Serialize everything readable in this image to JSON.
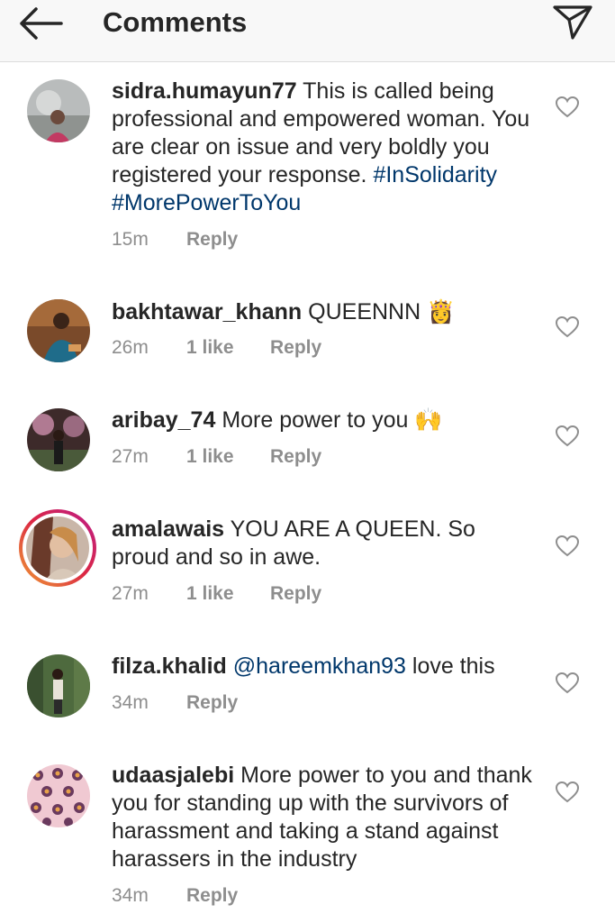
{
  "header": {
    "title": "Comments",
    "back_icon": "arrow-left-icon",
    "share_icon": "paper-plane-icon"
  },
  "comments": [
    {
      "username": "sidra.humayun77",
      "text": "This is called being professional and empowered woman. You are clear on issue and very boldly you registered your response.",
      "hashtags": [
        "#InSolidarity",
        "#MorePowerToYou"
      ],
      "time": "15m",
      "reply_label": "Reply"
    },
    {
      "username": "bakhtawar_khann",
      "text": "QUEENNN 👸",
      "time": "26m",
      "likes": "1 like",
      "reply_label": "Reply"
    },
    {
      "username": "aribay_74",
      "text": "More power to you 🙌",
      "time": "27m",
      "likes": "1 like",
      "reply_label": "Reply"
    },
    {
      "username": "amalawais",
      "text": "YOU ARE A QUEEN. So proud and so in awe.",
      "time": "27m",
      "likes": "1 like",
      "reply_label": "Reply"
    },
    {
      "username": "filza.khalid",
      "mention": "@hareemkhan93",
      "text": "love this",
      "time": "34m",
      "reply_label": "Reply"
    },
    {
      "username": "udaasjalebi",
      "text": "More power to you and thank you for standing up with the survivors of harassment and taking a stand against harassers in the industry",
      "time": "34m",
      "reply_label": "Reply"
    }
  ]
}
